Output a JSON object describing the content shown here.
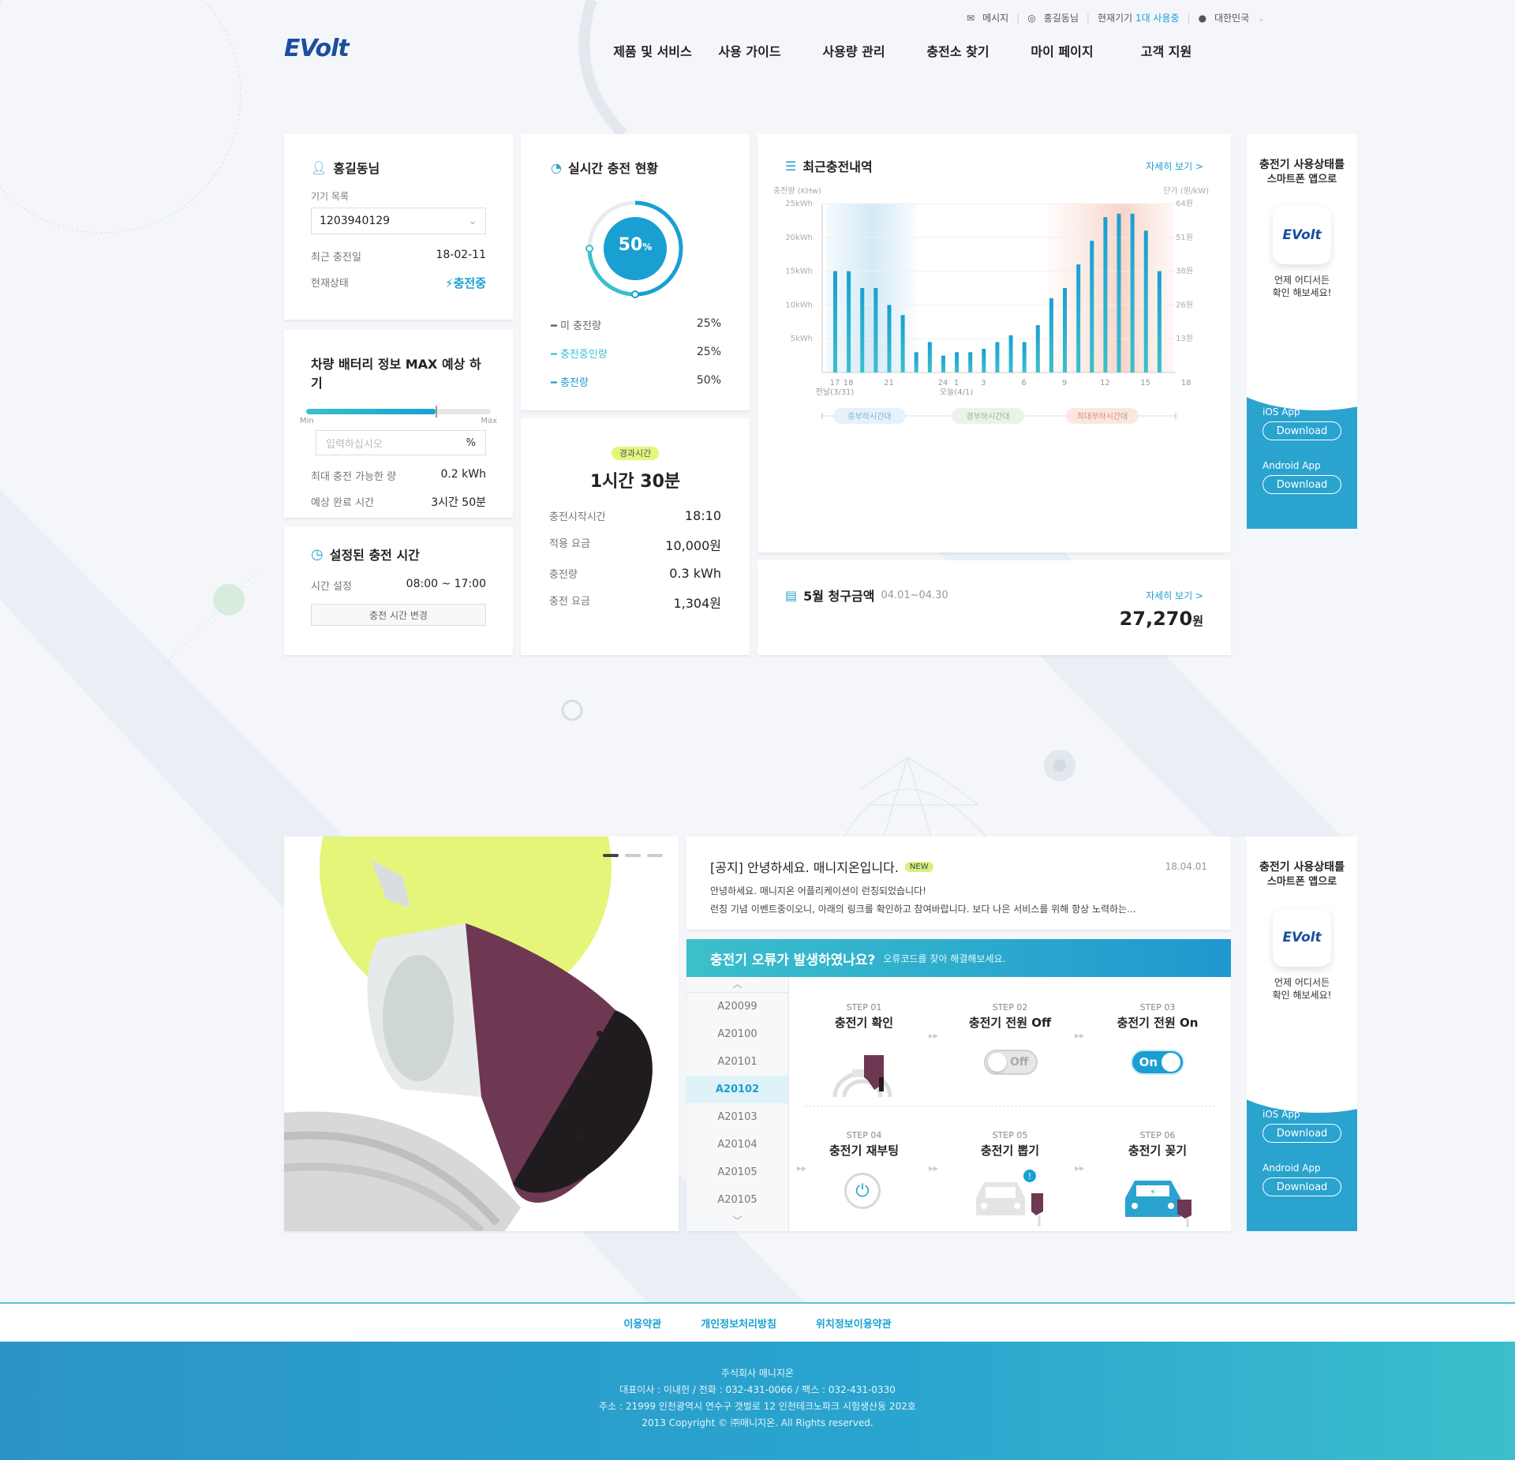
{
  "header": {
    "logo": "EVolt",
    "util": {
      "message": "메시지",
      "user": "홍길동님",
      "device_prefix": "현재기기",
      "device_count": "1대 사용중",
      "country": "대한민국"
    },
    "nav": [
      "제품 및 서비스",
      "사용 가이드",
      "사용량 관리",
      "충전소 찾기",
      "마이 페이지",
      "고객 지원"
    ]
  },
  "user_card": {
    "name": "홍길동님",
    "device_list_label": "기기 목록",
    "device_value": "1203940129",
    "recent_charge_label": "최근 충전일",
    "recent_charge_value": "18-02-11",
    "status_label": "현재상태",
    "status_value": "충전중"
  },
  "battery_card": {
    "title": "차량 배터리 정보 MAX 예상 하기",
    "slider_value": 0.7,
    "min": "Min",
    "max": "Max",
    "input_placeholder": "입력하십시오",
    "input_unit": "%",
    "max_charge_label": "최대 충전 가능한 량",
    "max_charge_value": "0.2 kWh",
    "finish_label": "예상 완료 시간",
    "finish_value": "3시간 50분"
  },
  "schedule_card": {
    "title": "설정된 충전 시간",
    "time_label": "시간 설정",
    "time_value": "08:00 ~ 17:00",
    "button": "충전 시간 변경"
  },
  "realtime_card": {
    "title": "실시간 충전 현황",
    "percent": "50",
    "percent_unit": "%",
    "legend": [
      {
        "label": "미 충전량",
        "value": "25%",
        "color": "#555555"
      },
      {
        "label": "충전중인량",
        "value": "25%",
        "color": "#3bbfcc"
      },
      {
        "label": "충전량",
        "value": "50%",
        "color": "#1a9fd2"
      }
    ]
  },
  "elapsed_card": {
    "badge": "경과시간",
    "elapsed": "1시간 30분",
    "rows": [
      {
        "k": "충전시작시간",
        "v": "18:10"
      },
      {
        "k": "적용 요금",
        "v": "10,000원"
      },
      {
        "k": "충전량",
        "v": "0.3 kWh"
      },
      {
        "k": "충전 요금",
        "v": "1,304원"
      }
    ]
  },
  "history_card": {
    "title": "최근충전내역",
    "more": "자세히 보기 >"
  },
  "chart_data": {
    "type": "bar",
    "title": "최근충전내역",
    "ylabel": "충전량 (KHw)",
    "ylabel_right": "단가 (원/kW)",
    "ylim": [
      0,
      25
    ],
    "yticks": [
      "5kWh",
      "10kWh",
      "15kWh",
      "20kWh",
      "25kWh"
    ],
    "yticks_right": [
      "13원",
      "26원",
      "38원",
      "51원",
      "64원"
    ],
    "x_tick_labels": [
      "17",
      "18",
      "21",
      "24",
      "1",
      "3",
      "6",
      "9",
      "12",
      "15",
      "18"
    ],
    "x_sub_labels": [
      "전날(3/31)",
      "오늘(4/1)"
    ],
    "values": [
      15,
      15,
      12.5,
      12.5,
      10,
      8.5,
      3,
      4.5,
      2.5,
      3,
      3,
      3.5,
      4.5,
      5.5,
      4.5,
      7,
      11,
      12.5,
      16,
      19.5,
      23,
      23.5,
      23.5,
      21,
      15
    ],
    "zones": [
      "중부하시간대",
      "경부하시간대",
      "최대부하시간대"
    ],
    "grid": true
  },
  "bill_card": {
    "title": "5월 청구금액",
    "period": "04.01~04.30",
    "more": "자세히 보기 >",
    "amount": "27,270",
    "unit": "원"
  },
  "ad": {
    "title1": "충전기 사용상태를",
    "title2": "스마트폰 앱으로",
    "app": "EVolt",
    "desc1": "언제 어디서든",
    "desc2": "확인 해보세요!",
    "ios": "iOS App",
    "android": "Android App",
    "download": "Download"
  },
  "notice": {
    "title": "[공지] 안녕하세요. 매니지온입니다.",
    "badge": "NEW",
    "date": "18.04.01",
    "line1": "안녕하세요. 매니지온 어플리케이션이 런칭되었습니다!",
    "line2": "런칭 기념 이벤트중이오니, 아래의 링크를 확인하고 참여바랍니다. 보다 나은 서비스를 위해 항상 노력하는..."
  },
  "error": {
    "title": "충전기 오류가 발생하였나요?",
    "subtitle": "오류코드를 찾아 해결해보세요.",
    "codes": [
      "A20099",
      "A20100",
      "A20101",
      "A20102",
      "A20103",
      "A20104",
      "A20105",
      "A20105"
    ],
    "selected": 3,
    "steps": [
      {
        "n": "STEP 01",
        "l": "충전기 확인"
      },
      {
        "n": "STEP 02",
        "l": "충전기 전원 Off"
      },
      {
        "n": "STEP 03",
        "l": "충전기 전원 On"
      },
      {
        "n": "STEP 04",
        "l": "충전기 재부팅"
      },
      {
        "n": "STEP 05",
        "l": "충전기 뽑기"
      },
      {
        "n": "STEP 06",
        "l": "충전기 꽂기"
      }
    ],
    "off": "Off",
    "on": "On"
  },
  "footer": {
    "links": [
      "이용약관",
      "개인정보처리방침",
      "위치정보이용약관"
    ],
    "company": "주식회사 매니지온",
    "contact": "대표이사 : 이내헌 / 전화 : 032-431-0066 / 팩스 : 032-431-0330",
    "address": "주소 : 21999 인천광역시 연수구 갯벌로 12 인천테크노파크 시험생산동 202호",
    "copyright": "2013 Copyright © ㈜매니지온. All Rights reserved."
  },
  "colors": {
    "accent": "#1a9fd2",
    "teal": "#3bbfcc",
    "plug": "#7a3b55",
    "lime": "#e4f57a"
  }
}
